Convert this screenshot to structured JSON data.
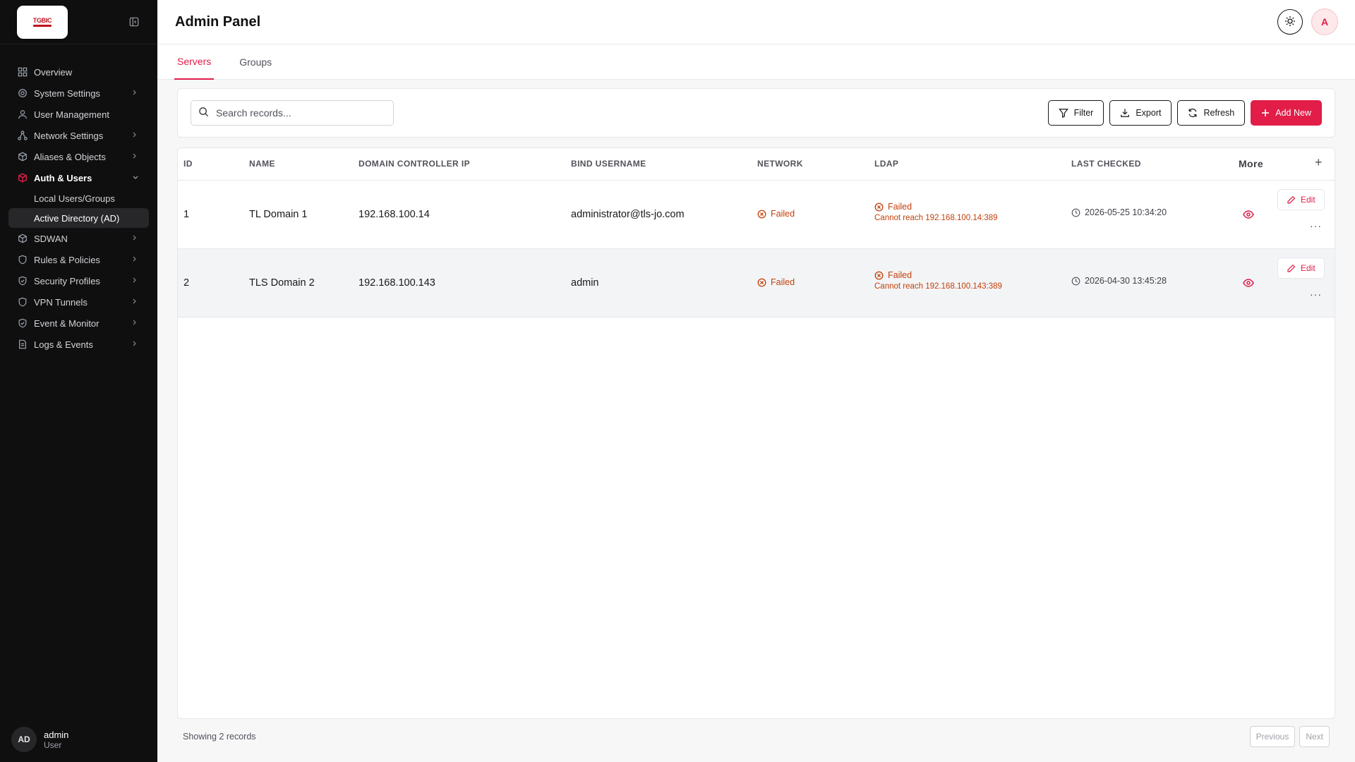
{
  "sidebar": {
    "logo_text": "TGBIC",
    "items": [
      {
        "label": "Overview",
        "has_chevron": false
      },
      {
        "label": "System Settings",
        "has_chevron": true
      },
      {
        "label": "User Management",
        "has_chevron": false
      },
      {
        "label": "Network Settings",
        "has_chevron": true
      },
      {
        "label": "Aliases & Objects",
        "has_chevron": true
      },
      {
        "label": "Auth & Users",
        "has_chevron": true,
        "expanded": true
      },
      {
        "label": "SDWAN",
        "has_chevron": true
      },
      {
        "label": "Rules & Policies",
        "has_chevron": true
      },
      {
        "label": "Security Profiles",
        "has_chevron": true
      },
      {
        "label": "VPN Tunnels",
        "has_chevron": true
      },
      {
        "label": "Event & Monitor",
        "has_chevron": true
      },
      {
        "label": "Logs & Events",
        "has_chevron": true
      }
    ],
    "sub_items": [
      {
        "label": "Local Users/Groups"
      },
      {
        "label": "Active Directory (AD)"
      }
    ],
    "user": {
      "initials": "AD",
      "name": "admin",
      "role": "User"
    }
  },
  "header": {
    "title": "Admin Panel",
    "avatar_initial": "A"
  },
  "tabs": [
    {
      "label": "Servers",
      "active": true
    },
    {
      "label": "Groups",
      "active": false
    }
  ],
  "toolbar": {
    "search_placeholder": "Search records...",
    "filter_label": "Filter",
    "export_label": "Export",
    "refresh_label": "Refresh",
    "add_label": "Add New"
  },
  "table": {
    "columns": [
      "ID",
      "NAME",
      "DOMAIN CONTROLLER IP",
      "BIND USERNAME",
      "NETWORK",
      "LDAP",
      "LAST CHECKED",
      "More",
      "+"
    ],
    "rows": [
      {
        "id": "1",
        "name": "TL Domain 1",
        "ip": "192.168.100.14",
        "bind": "administrator@tls-jo.com",
        "network": "Failed",
        "ldap": "Failed",
        "ldap_error": "Cannot reach 192.168.100.14:389",
        "last_checked": "2026-05-25 10:34:20",
        "edit_label": "Edit",
        "more": "···"
      },
      {
        "id": "2",
        "name": "TLS Domain 2",
        "ip": "192.168.100.143",
        "bind": "admin",
        "network": "Failed",
        "ldap": "Failed",
        "ldap_error": "Cannot reach 192.168.100.143:389",
        "last_checked": "2026-04-30 13:45:28",
        "edit_label": "Edit",
        "more": "···"
      }
    ]
  },
  "footer": {
    "showing": "Showing 2 records",
    "previous": "Previous",
    "next": "Next"
  },
  "colors": {
    "accent": "#e11d48",
    "sidebar_bg": "#0f0f10",
    "status_failed": "#c2410c"
  }
}
